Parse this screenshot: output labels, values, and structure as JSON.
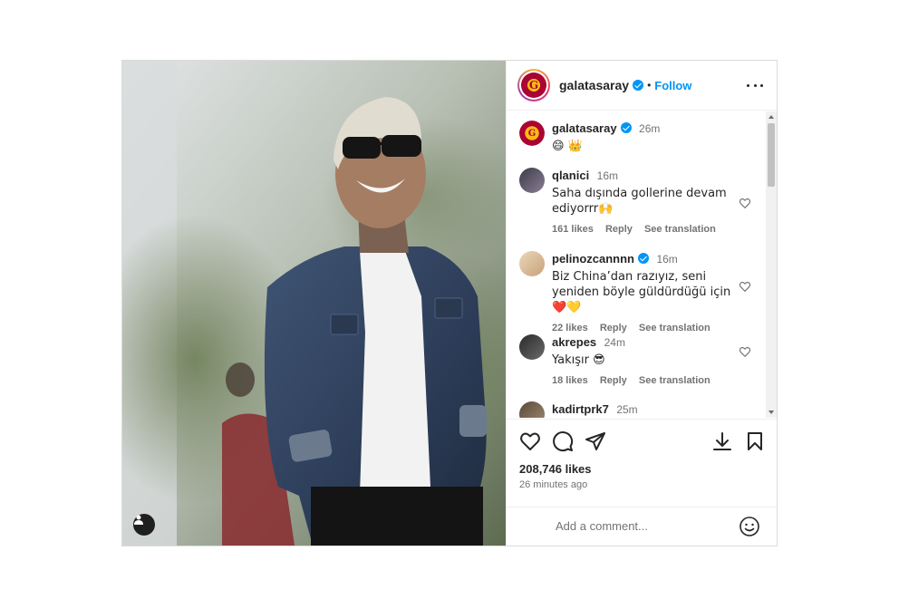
{
  "post": {
    "author": "galatasaray",
    "follow_label": "Follow",
    "dot": "•",
    "caption": {
      "username": "galatasaray",
      "time": "26m",
      "text": "😄 👑"
    },
    "comments": [
      {
        "username": "qlanici",
        "time": "16m",
        "text": "Saha dışında gollerine devam ediyorrr🙌",
        "likes": "161 likes",
        "reply": "Reply",
        "see_translation": "See translation",
        "verified": false
      },
      {
        "username": "pelinozcannnn",
        "time": "16m",
        "text": "Biz China’dan razıyız, seni yeniden böyle güldürdüğü için❤️💛",
        "likes": "22 likes",
        "reply": "Reply",
        "see_translation": "See translation",
        "verified": true
      },
      {
        "username": "akrepes",
        "time": "24m",
        "text": "Yakışır 😎",
        "likes": "18 likes",
        "reply": "Reply",
        "see_translation": "See translation",
        "verified": false
      },
      {
        "username": "kadirtprk7",
        "time": "25m",
        "text": "",
        "likes": "",
        "reply": "",
        "see_translation": "",
        "verified": false
      }
    ],
    "likes_count": "208,746 likes",
    "time_ago": "26 minutes ago",
    "add_comment_placeholder": "Add a comment...",
    "crest_letter": "G"
  },
  "colors": {
    "accent": "#0095f6",
    "text": "#262626",
    "muted": "#737373",
    "border": "#dbdbdb",
    "brand_red": "#a90432",
    "brand_yellow": "#fdb913"
  },
  "icons": [
    "more-icon",
    "verified-icon",
    "heart-icon",
    "comment-icon",
    "share-icon",
    "save-icon",
    "download-icon",
    "emoji-icon",
    "user-tag-icon"
  ]
}
